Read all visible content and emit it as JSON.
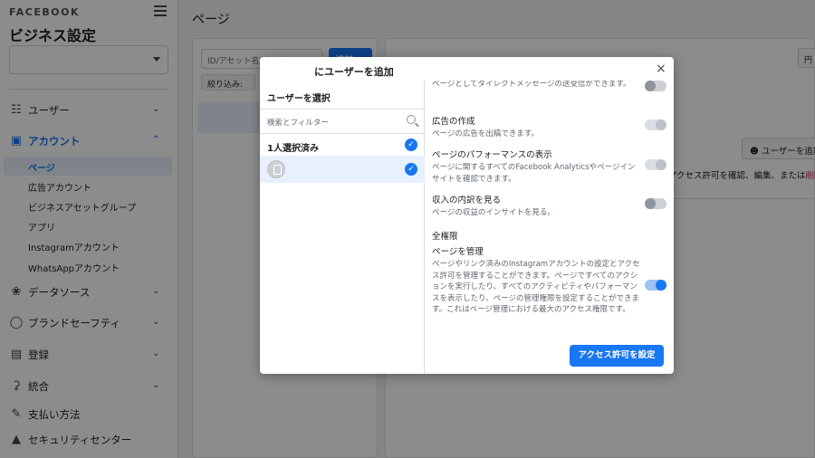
{
  "sidebar": {
    "brand": "FACEBOOK",
    "title": "ビジネス設定",
    "groups": [
      {
        "label": "ユーザー"
      },
      {
        "label": "アカウント"
      },
      {
        "label": "データソース"
      },
      {
        "label": "ブランドセーフティ"
      },
      {
        "label": "登録"
      },
      {
        "label": "統合"
      },
      {
        "label": "支払い方法"
      },
      {
        "label": "セキュリティセンター"
      }
    ],
    "account_items": [
      {
        "label": "ページ"
      },
      {
        "label": "広告アカウント"
      },
      {
        "label": "ビジネスアセットグループ"
      },
      {
        "label": "アプリ"
      },
      {
        "label": "Instagramアカウント"
      },
      {
        "label": "WhatsAppアカウント"
      }
    ]
  },
  "main": {
    "page_title": "ページ",
    "search_placeholder": "ID/アセット名/ビジネス",
    "add_button": "追加",
    "filter_label": "絞り込み:",
    "top_right_button": "円",
    "add_user_button": "ユーザーを追加",
    "desc_prefix": "アクセス許可を確認、編集、または",
    "desc_red": "削除"
  },
  "modal": {
    "title": "にユーザーを追加",
    "close": "×",
    "select_title": "ユーザーを選択",
    "search_placeholder": "検索とフィルター",
    "selected_count": "1人選択済み",
    "permissions": [
      {
        "title": "",
        "desc": "ページとしてダイレクトメッセージの送受信ができます。",
        "state": "off"
      },
      {
        "title": "広告の作成",
        "desc": "ページの広告を出稿できます。",
        "state": "dis"
      },
      {
        "title": "ページのパフォーマンスの表示",
        "desc": "ページに関するすべてのFacebook Analyticsやページインサイトを確認できます。",
        "state": "dis"
      },
      {
        "title": "収入の内訳を見る",
        "desc": "ページの収益のインサイトを見る。",
        "state": "off"
      }
    ],
    "full_section": "全権限",
    "manage": {
      "title": "ページを管理",
      "desc": "ページやリンク済みのInstagramアカウントの設定とアクセス許可を管理することができます。ページですべてのアクションを実行したり、すべてのアクティビティやパフォーマンスを表示したり、ページの管理権限を設定することができます。これはページ管理における最大のアクセス権限です。",
      "state": "on"
    },
    "submit": "アクセス許可を設定"
  }
}
